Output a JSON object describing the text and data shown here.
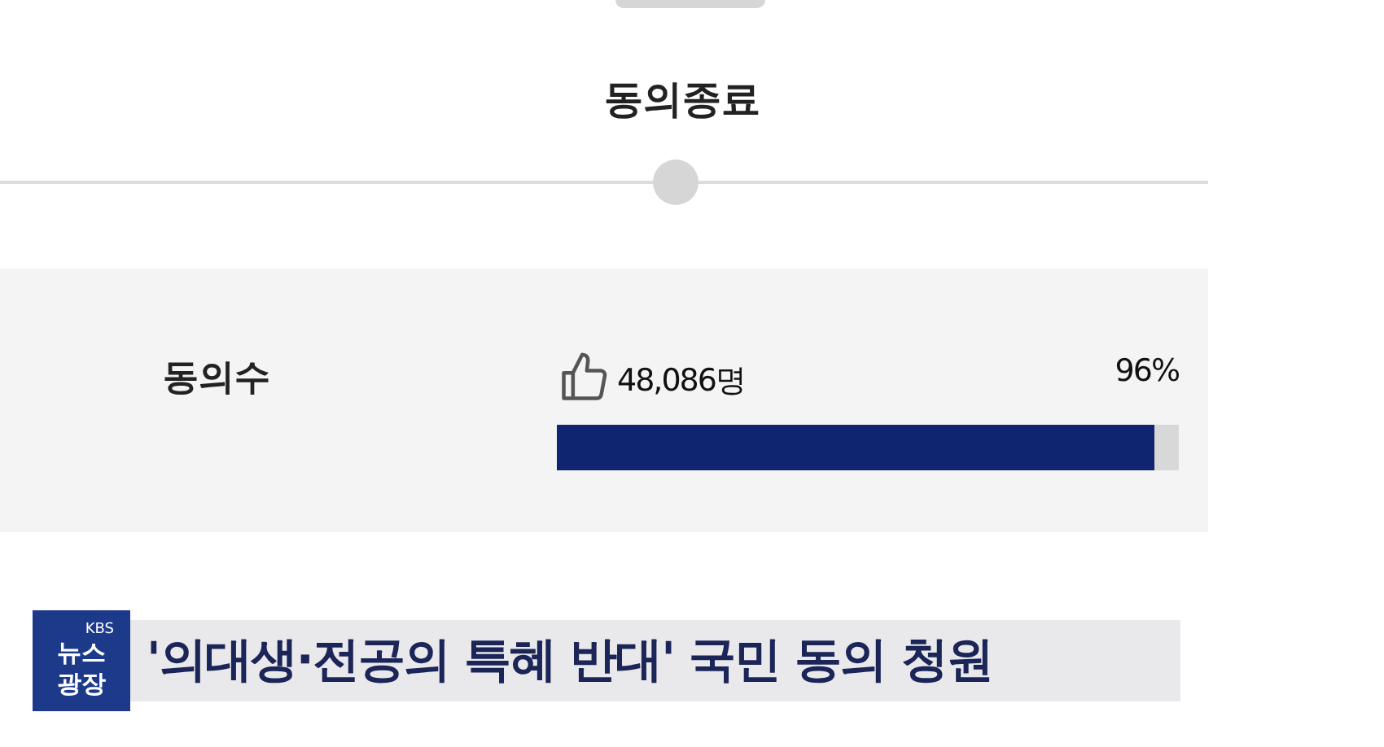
{
  "status": {
    "title": "동의종료"
  },
  "agreement": {
    "label": "동의수",
    "count": "48,086명",
    "percent": "96%",
    "level": 0.96
  },
  "caption": {
    "logo": [
      "KBS",
      "뉴스",
      "광장"
    ],
    "headline": "'의대생·전공의 특혜 반대' 국민 동의 청원"
  }
}
